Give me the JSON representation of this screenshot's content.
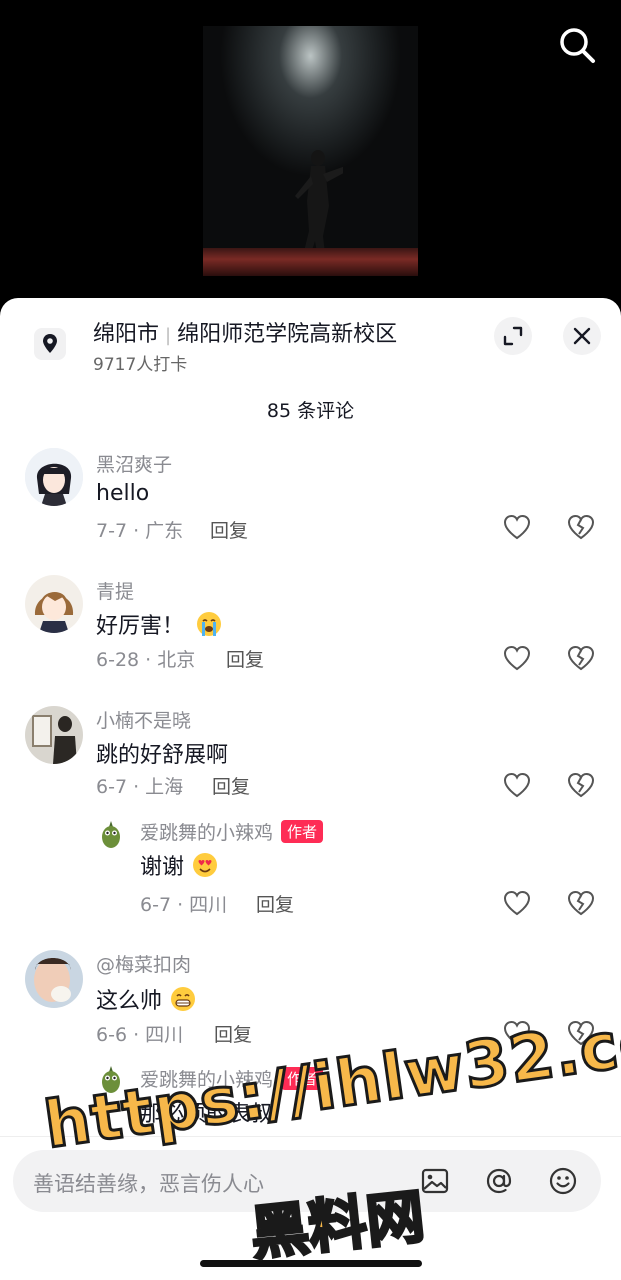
{
  "location": {
    "city": "绵阳市",
    "place": "绵阳师范学院高新校区",
    "checkins": "9717人打卡"
  },
  "comments_header": "85 条评论",
  "reply_label": "回复",
  "author_badge": "作者",
  "comments": [
    {
      "user": "黑沼爽子",
      "text": "hello",
      "meta": "7-7 · 广东"
    },
    {
      "user": "青提",
      "text": "好厉害！",
      "meta": "6-28 · 北京",
      "emoji": "loudly-crying-face"
    },
    {
      "user": "小楠不是晓",
      "text": "跳的好舒展啊",
      "meta": "6-7 · 上海"
    },
    {
      "user": "爱跳舞的小辣鸡",
      "text": "谢谢",
      "meta": "6-7 · 四川",
      "emoji": "heart-eyes-face",
      "is_reply": true
    },
    {
      "user": "@梅菜扣肉",
      "text": "这么帅",
      "meta": "6-6 · 四川",
      "emoji": "grinning-face"
    },
    {
      "user": "爱跳舞的小辣鸡",
      "text": "那必须的表叔",
      "is_reply": true
    }
  ],
  "input": {
    "placeholder": "善语结善缘，恶言伤人心"
  },
  "icons": [
    "search-icon",
    "location-pin-icon",
    "expand-icon",
    "close-icon",
    "heart-icon",
    "broken-heart-icon",
    "image-icon",
    "at-icon",
    "emoji-icon"
  ],
  "watermark": {
    "line1": "https://ihlw32.com",
    "line2": "黑料网"
  },
  "colors": {
    "accent": "#fe2c55",
    "watermark": "#f7b84a"
  }
}
